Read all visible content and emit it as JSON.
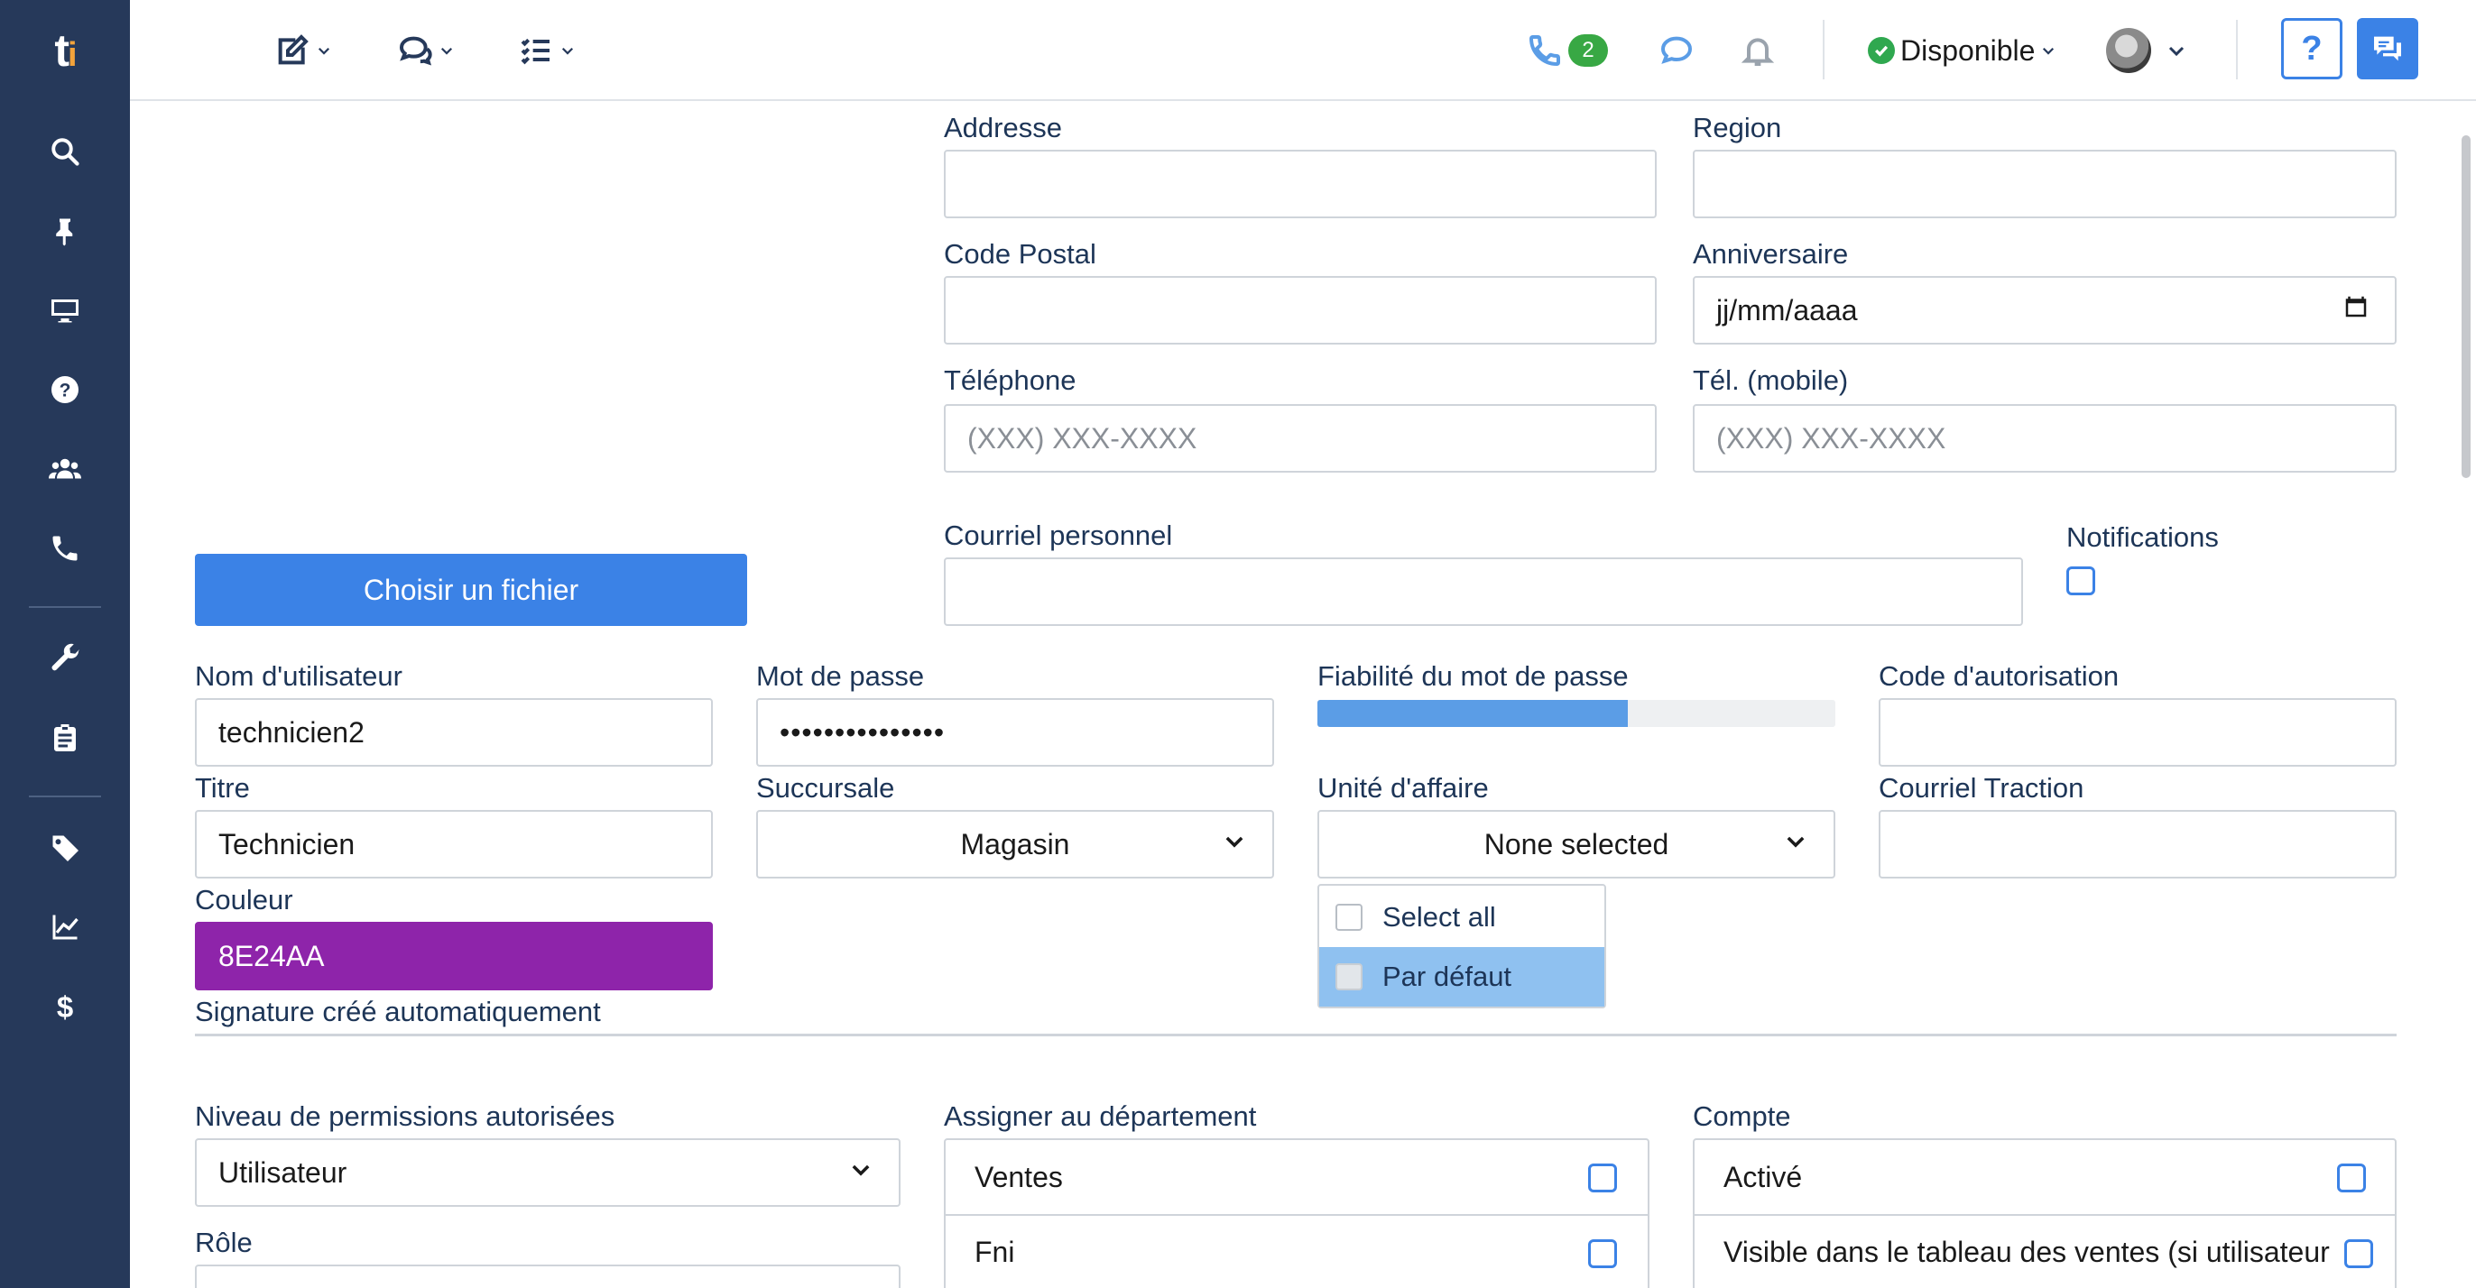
{
  "sidebar": {
    "logo": "t",
    "logo_accent": "i",
    "items": [
      {
        "name": "search",
        "icon": "search-icon"
      },
      {
        "name": "pin",
        "icon": "pin-icon"
      },
      {
        "name": "monitor",
        "icon": "monitor-icon"
      },
      {
        "name": "help",
        "icon": "question-circle-icon"
      },
      {
        "name": "users",
        "icon": "users-icon"
      },
      {
        "name": "phone",
        "icon": "phone-icon"
      },
      {
        "name": "tools",
        "icon": "wrench-icon"
      },
      {
        "name": "clipboard",
        "icon": "clipboard-icon"
      },
      {
        "name": "tags",
        "icon": "tag-icon"
      },
      {
        "name": "reports",
        "icon": "chart-line-icon"
      },
      {
        "name": "billing",
        "icon": "dollar-icon"
      }
    ]
  },
  "topbar": {
    "phone_badge": "2",
    "status_label": "Disponible",
    "help_label": "?"
  },
  "form": {
    "address": {
      "label": "Addresse",
      "value": ""
    },
    "region": {
      "label": "Region",
      "value": ""
    },
    "postal_code": {
      "label": "Code Postal",
      "value": ""
    },
    "birthday": {
      "label": "Anniversaire",
      "value": "jj/mm/aaaa"
    },
    "phone": {
      "label": "Téléphone",
      "placeholder": "(XXX) XXX-XXXX"
    },
    "mobile": {
      "label": "Tél. (mobile)",
      "placeholder": "(XXX) XXX-XXXX"
    },
    "personal_email": {
      "label": "Courriel personnel",
      "value": ""
    },
    "notifications": {
      "label": "Notifications",
      "checked": false
    },
    "file_button": "Choisir un fichier",
    "username": {
      "label": "Nom d'utilisateur",
      "value": "technicien2"
    },
    "password": {
      "label": "Mot de passe",
      "value": "•••••••••••••••"
    },
    "password_strength": {
      "label": "Fiabilité du mot de passe",
      "level": 0.6
    },
    "auth_code": {
      "label": "Code d'autorisation",
      "value": ""
    },
    "title": {
      "label": "Titre",
      "value": "Technicien"
    },
    "branch": {
      "label": "Succursale",
      "value": "Magasin"
    },
    "business_unit": {
      "label": "Unité d'affaire",
      "value": "None selected",
      "options": [
        {
          "label": "Select all",
          "checked": false
        },
        {
          "label": "Par défaut",
          "checked": false,
          "highlighted": true
        }
      ]
    },
    "traction_email": {
      "label": "Courriel Traction",
      "value": ""
    },
    "color": {
      "label": "Couleur",
      "value": "8E24AA",
      "hex": "#8e24aa"
    },
    "signature_note": "Signature créé automatiquement",
    "permission_level": {
      "label": "Niveau de permissions autorisées",
      "value": "Utilisateur"
    },
    "role": {
      "label": "Rôle"
    },
    "departments": {
      "label": "Assigner au département",
      "items": [
        {
          "label": "Ventes",
          "checked": false
        },
        {
          "label": "Fni",
          "checked": false
        }
      ]
    },
    "account": {
      "label": "Compte",
      "items": [
        {
          "label": "Activé",
          "checked": false
        },
        {
          "label": "Visible dans le tableau des ventes (si utilisateur",
          "checked": false
        }
      ]
    }
  },
  "colors": {
    "sidebar_bg": "#26395a",
    "accent": "#3b82e6",
    "status_green": "#2fa84f"
  }
}
